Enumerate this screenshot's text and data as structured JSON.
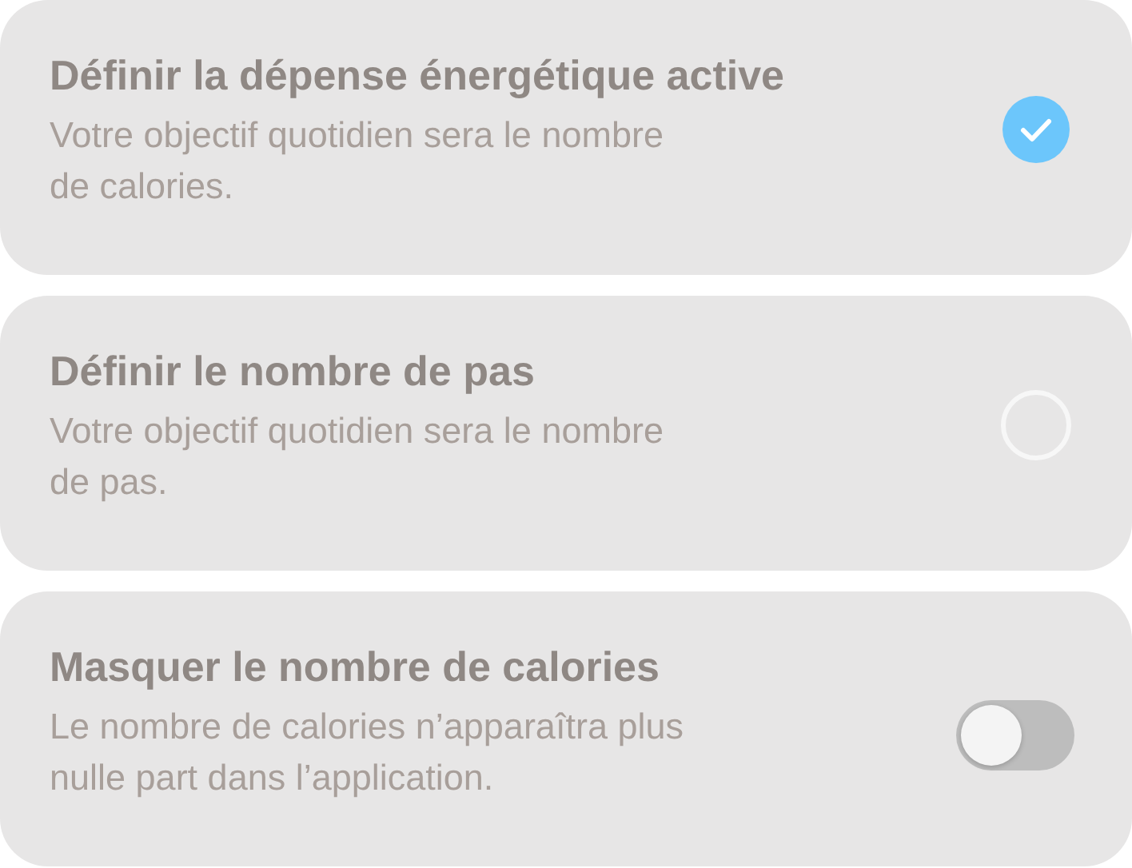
{
  "options": [
    {
      "kind": "check",
      "title": "Définir la dépense énergétique active",
      "description": "Votre objectif quotidien sera le nombre de calories.",
      "checked": true
    },
    {
      "kind": "check",
      "title": "Définir le nombre de pas",
      "description": "Votre objectif quotidien sera le nombre de pas.",
      "checked": false
    },
    {
      "kind": "toggle",
      "title": "Masquer le nombre de calories",
      "description": "Le nombre de calories n’apparaîtra plus nulle part dans l’application.",
      "on": false
    }
  ]
}
